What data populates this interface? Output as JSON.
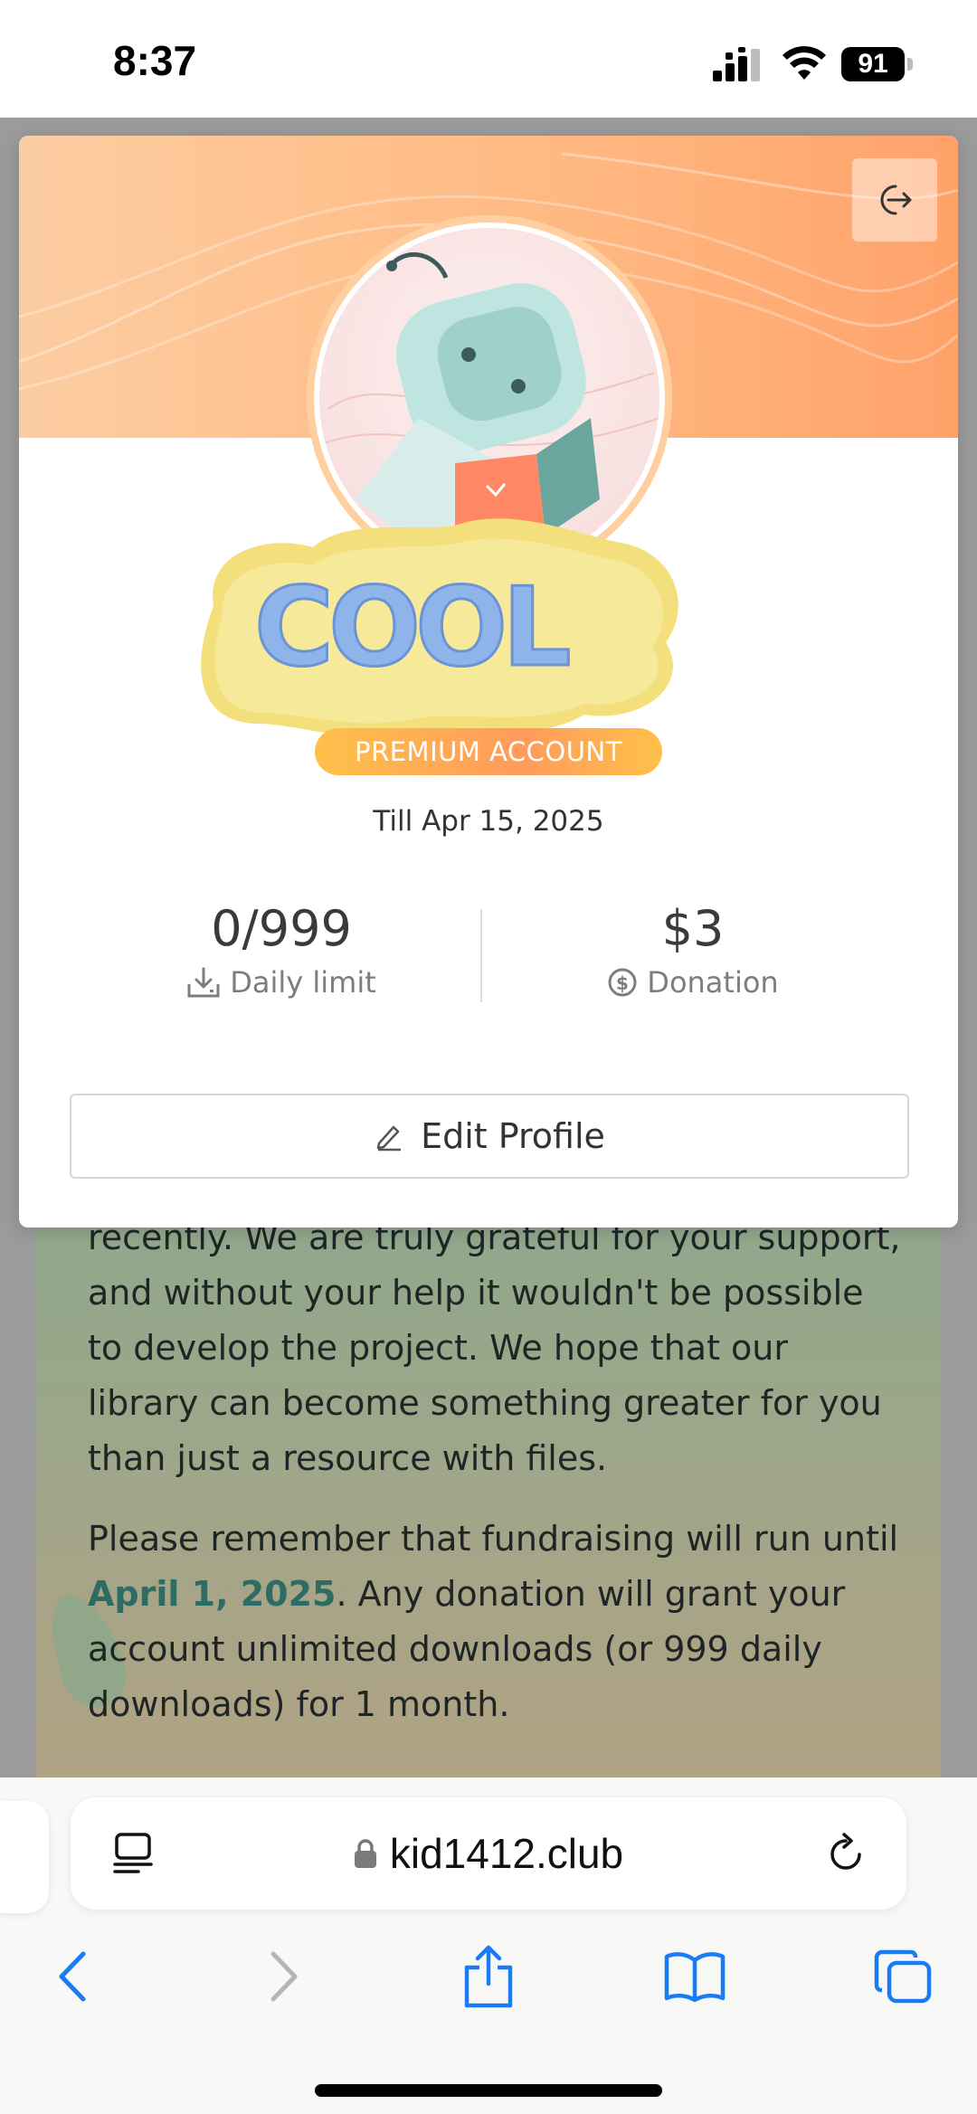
{
  "status_bar": {
    "time": "8:37",
    "battery": "91"
  },
  "page": {
    "paragraph1_partial": "recently. We are truly grateful for your support, and without your help it wouldn't be possible to develop the project. We hope that our library can become something greater for you than just a resource with files.",
    "paragraph2_prefix": "Please remember that fundraising will run until ",
    "paragraph2_highlight": "April 1, 2025",
    "paragraph2_suffix": ". Any donation will grant your account unlimited downloads (or 999 daily downloads) for 1 month."
  },
  "profile_modal": {
    "badge_text": "COOL",
    "account_type": "PREMIUM ACCOUNT",
    "expiry": "Till Apr 15, 2025",
    "daily_limit": {
      "value": "0/999",
      "label": "Daily limit",
      "icon": "download-icon"
    },
    "donation": {
      "value": "$3",
      "label": "Donation",
      "icon": "dollar-circle-icon"
    },
    "edit_button": "Edit Profile",
    "logout_icon": "logout-icon"
  },
  "browser": {
    "url": "kid1412.club",
    "icons": [
      "reader-icon",
      "lock-icon",
      "reload-icon",
      "back-icon",
      "forward-icon",
      "share-icon",
      "bookmarks-icon",
      "tabs-icon"
    ],
    "accent": "#1a7cf5"
  }
}
